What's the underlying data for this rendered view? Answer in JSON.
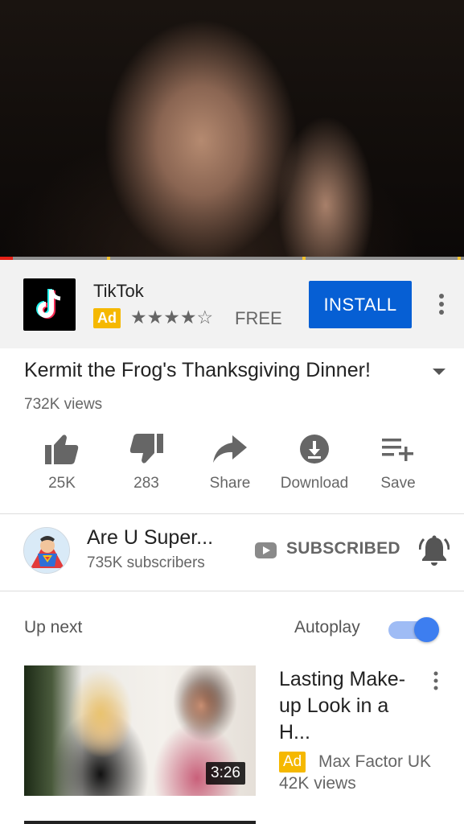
{
  "player": {
    "progress_fraction": 0.028
  },
  "ad": {
    "app_name": "TikTok",
    "badge": "Ad",
    "rating_stars": "★★★★☆",
    "price": "FREE",
    "install_label": "INSTALL"
  },
  "video": {
    "title": "Kermit the Frog's Thanksgiving Dinner!",
    "views": "732K views"
  },
  "actions": {
    "like": "25K",
    "dislike": "283",
    "share": "Share",
    "download": "Download",
    "save": "Save"
  },
  "channel": {
    "name": "Are U Super...",
    "subscribers": "735K subscribers",
    "subscribed_label": "SUBSCRIBED"
  },
  "upnext": {
    "heading": "Up next",
    "autoplay_label": "Autoplay",
    "autoplay_on": true,
    "items": [
      {
        "title": "Lasting Make-up Look in a H...",
        "badge": "Ad",
        "channel": "Max Factor UK",
        "views": "42K views",
        "duration": "3:26"
      }
    ]
  },
  "colors": {
    "accent_blue": "#065fd4",
    "ad_yellow": "#f5b800",
    "progress_red": "#e62117"
  }
}
